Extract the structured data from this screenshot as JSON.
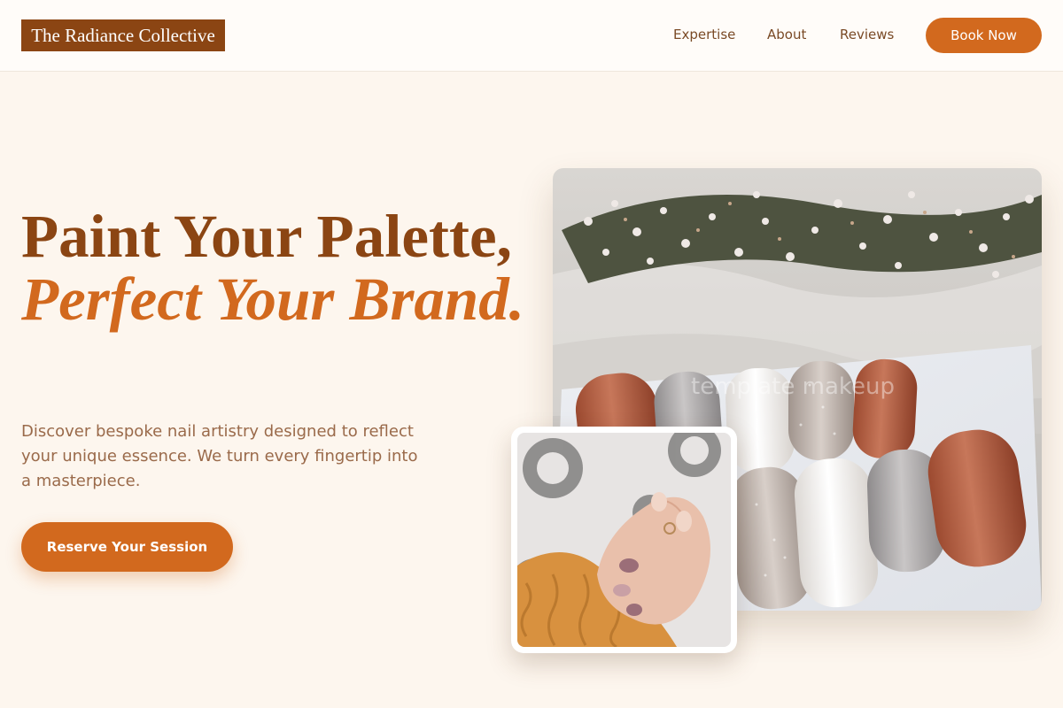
{
  "header": {
    "brand": "The Radiance Collective",
    "nav": [
      "Expertise",
      "About",
      "Reviews"
    ],
    "book_label": "Book Now"
  },
  "hero": {
    "title_line1": "Paint Your Palette,",
    "title_line2": "Perfect Your Brand.",
    "lead": "Discover bespoke nail artistry designed to reflect your unique essence. We turn every fingertip into a masterpiece.",
    "cta_label": "Reserve Your Session"
  },
  "images": {
    "main_alt": "Press-on nail set with dried flowers",
    "inset_alt": "Manicured hand holding knitted sweater",
    "watermark": "template makeup"
  },
  "colors": {
    "brand_brown": "#8b4513",
    "accent_orange": "#d2691e",
    "background": "#fdf6ee"
  }
}
